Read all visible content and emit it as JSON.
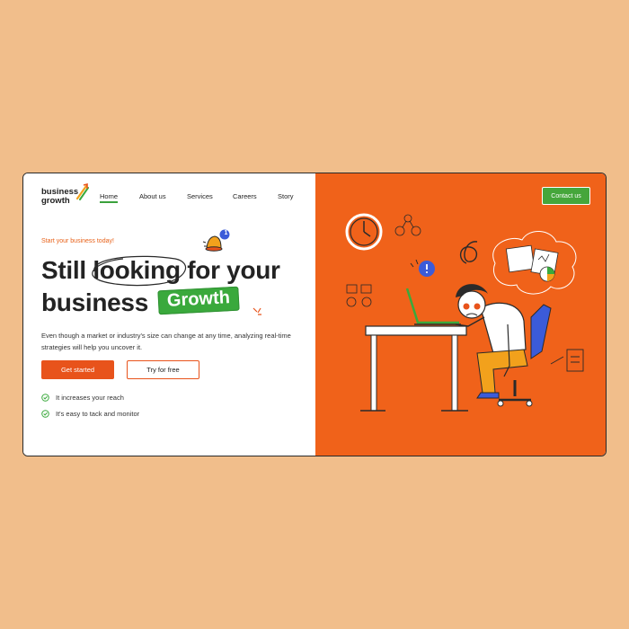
{
  "brand": {
    "line1": "business",
    "line2": "growth",
    "accent": "#e8531b",
    "green": "#3aa93c"
  },
  "nav": {
    "items": [
      "Home",
      "About us",
      "Services",
      "Careers",
      "Story"
    ],
    "active": "Home",
    "contact_label": "Contact us"
  },
  "hero": {
    "kicker": "Start your business today!",
    "headline_part1": "Still",
    "headline_highlight": "looking",
    "headline_part2": "for your",
    "headline_line2": "business",
    "growth_tag": "Growth",
    "description": "Even though a market or industry's size can change at any time, analyzing real-time strategies will help you uncover it.",
    "primary_cta": "Get started",
    "secondary_cta": "Try for free",
    "features": [
      "It increases your reach",
      "It's easy to tack and monitor"
    ]
  },
  "notification": {
    "icon": "bell-icon",
    "count": "1"
  },
  "illustration": {
    "name": "stressed-worker-at-desk",
    "background": "#f0621a"
  }
}
